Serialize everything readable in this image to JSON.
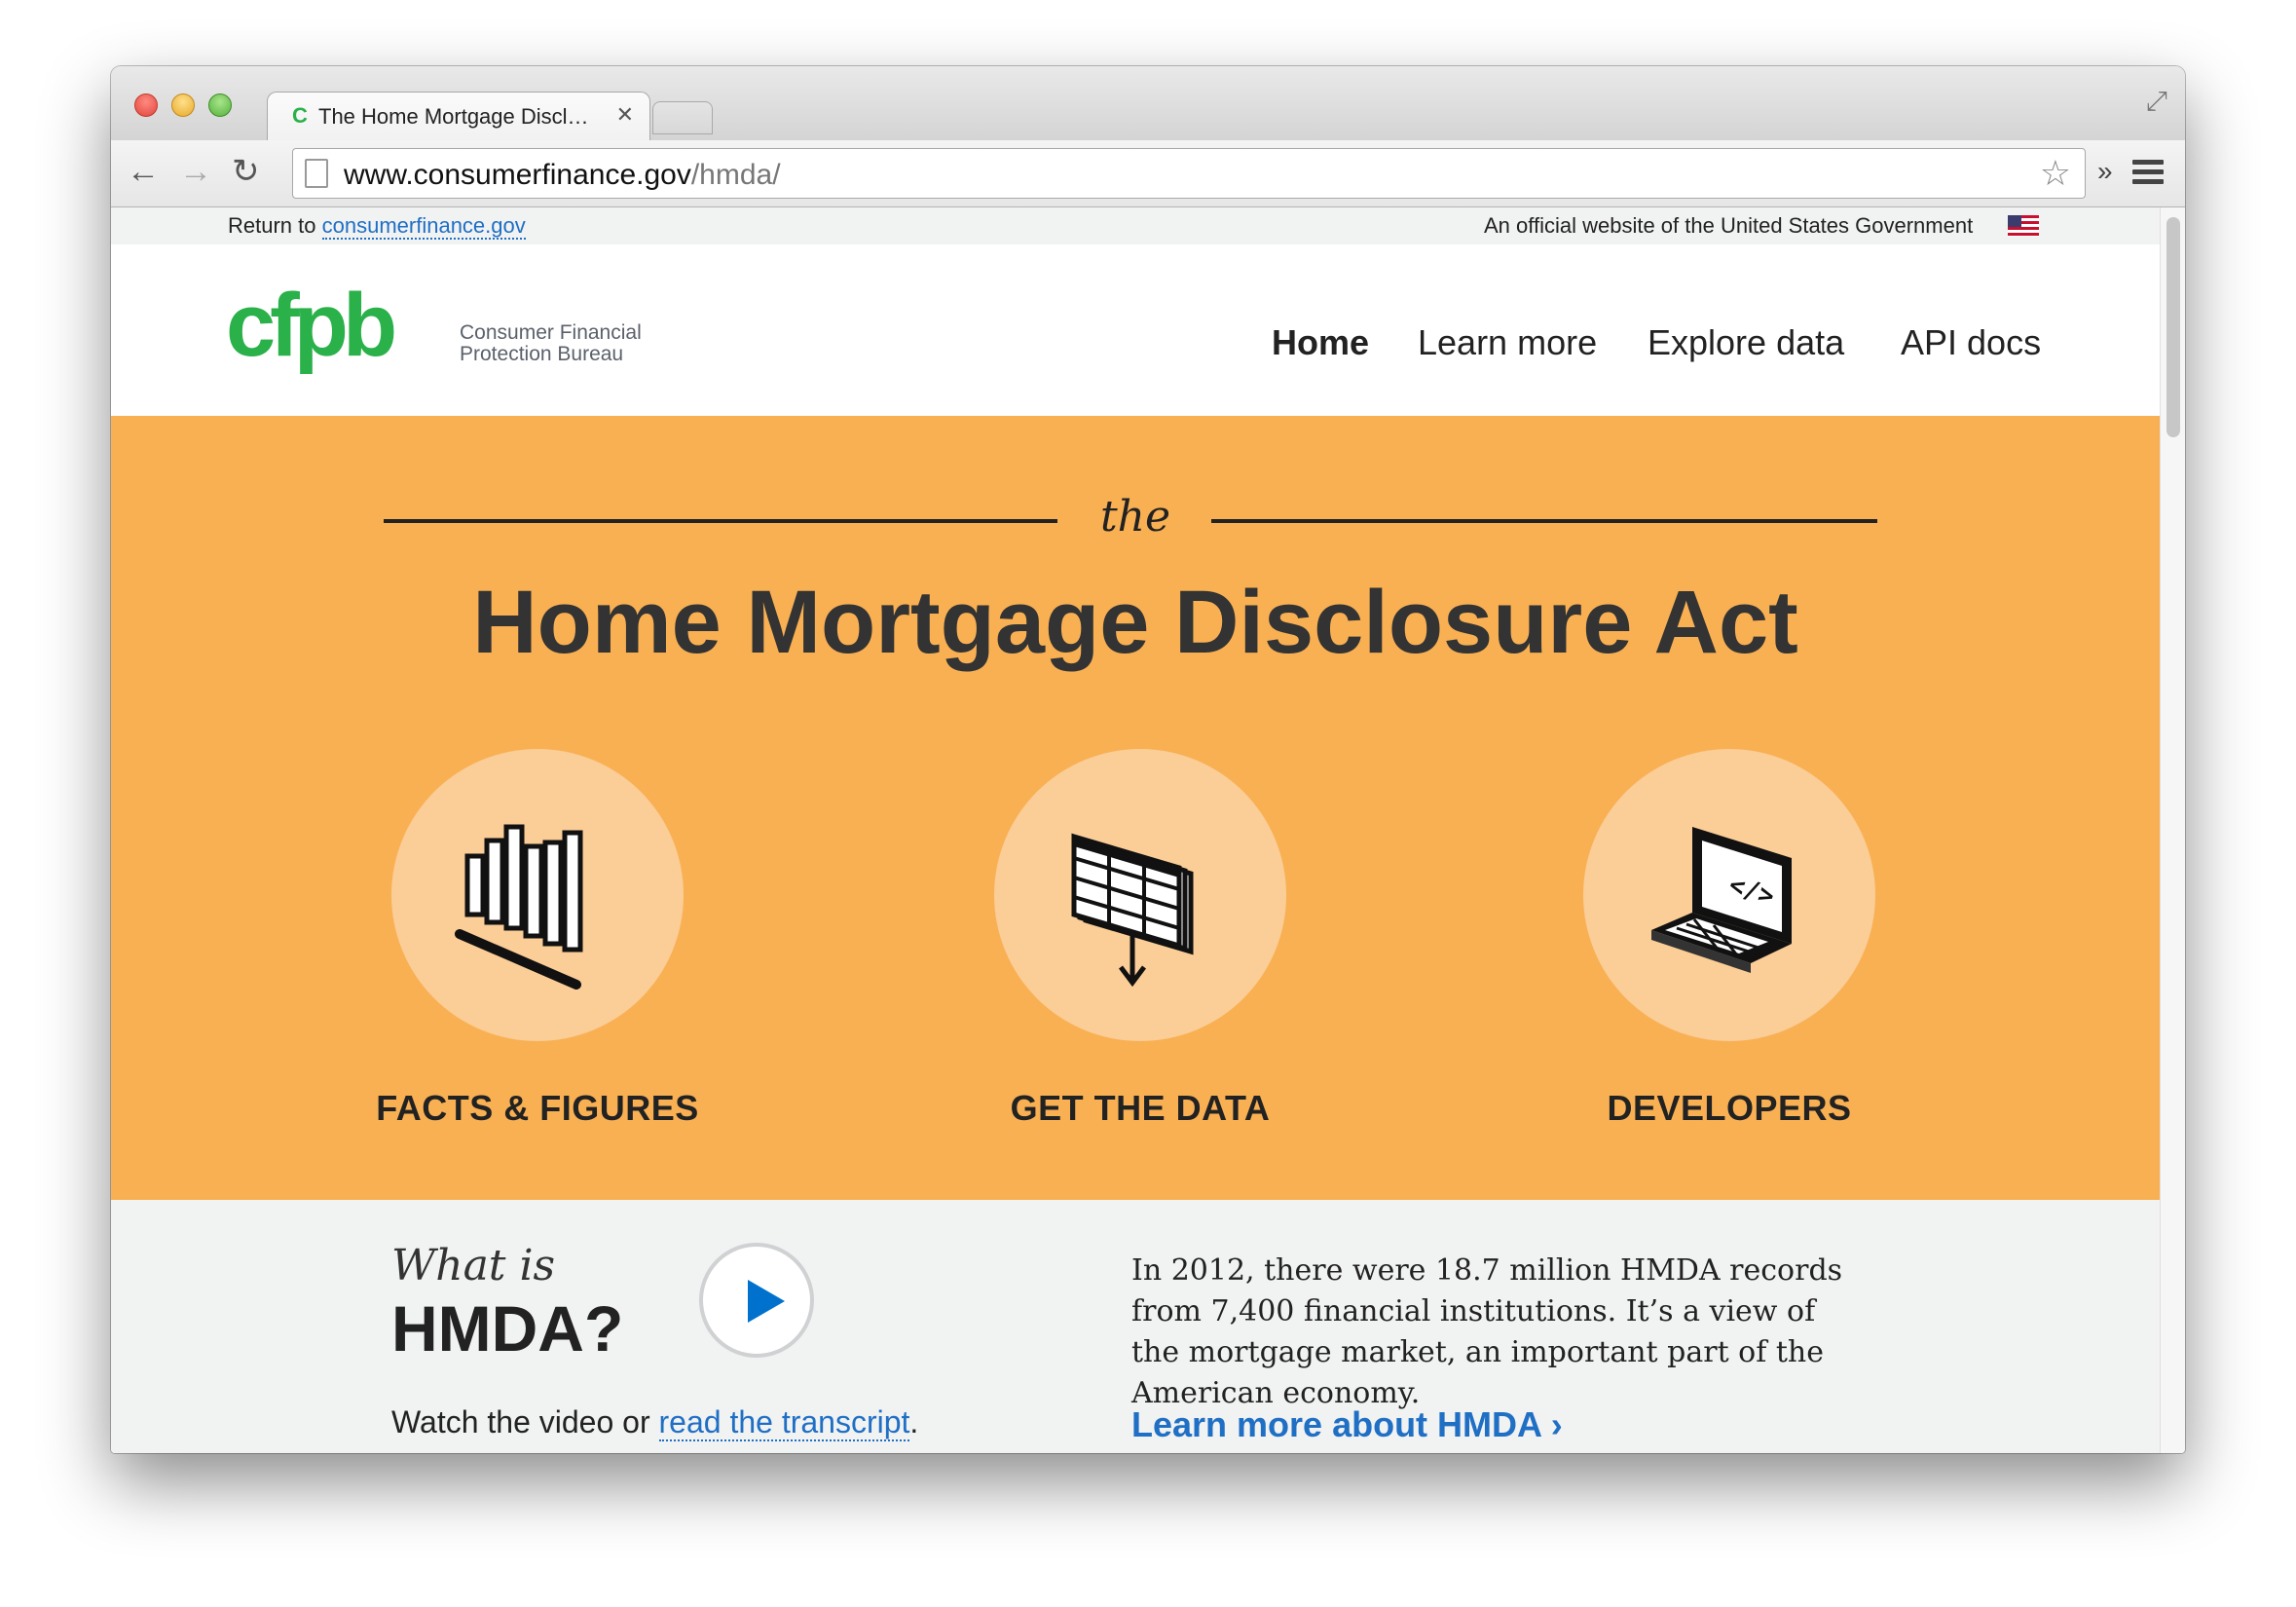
{
  "browser": {
    "tab_title": "The Home Mortgage Discl…",
    "tab_favicon": "C",
    "close_glyph": "✕",
    "url_host": "www.consumerfinance.gov",
    "url_path": "/hmda/",
    "back_glyph": "←",
    "forward_glyph": "→",
    "reload_glyph": "↻",
    "star_glyph": "☆",
    "more_glyph": "»",
    "fullscreen_glyph": "⤢"
  },
  "govbar": {
    "return_prefix": "Return to",
    "return_link": "consumerfinance.gov",
    "official": "An official website of the United States Government"
  },
  "header": {
    "logo_text": "cfpb",
    "logo_sub_line1": "Consumer Financial",
    "logo_sub_line2": "Protection Bureau",
    "nav": [
      "Home",
      "Learn more",
      "Explore data",
      "API docs"
    ]
  },
  "hero": {
    "kicker": "the",
    "title": "Home Mortgage Disclosure Act",
    "cards": [
      {
        "label": "FACTS & FIGURES",
        "icon": "bar-chart-icon"
      },
      {
        "label": "GET THE DATA",
        "icon": "data-table-download-icon"
      },
      {
        "label": "DEVELOPERS",
        "icon": "laptop-code-icon"
      }
    ]
  },
  "lower": {
    "what_is": "What is",
    "hmda": "HMDA?",
    "watch_prefix": "Watch the video or",
    "transcript_link": "read the transcript",
    "watch_suffix": ".",
    "stats": "In 2012, there were 18.7 million HMDA records from 7,400 financial institutions. It’s a view of the mortgage market, an important part of the American economy.",
    "learn_link": "Learn more about HMDA ›"
  },
  "colors": {
    "hero_bg": "#f9b053",
    "circle_bg": "#fbcd97",
    "link_blue": "#1f6fc5",
    "brand_green": "#2ab14a",
    "brand_light_green": "#addc91"
  }
}
